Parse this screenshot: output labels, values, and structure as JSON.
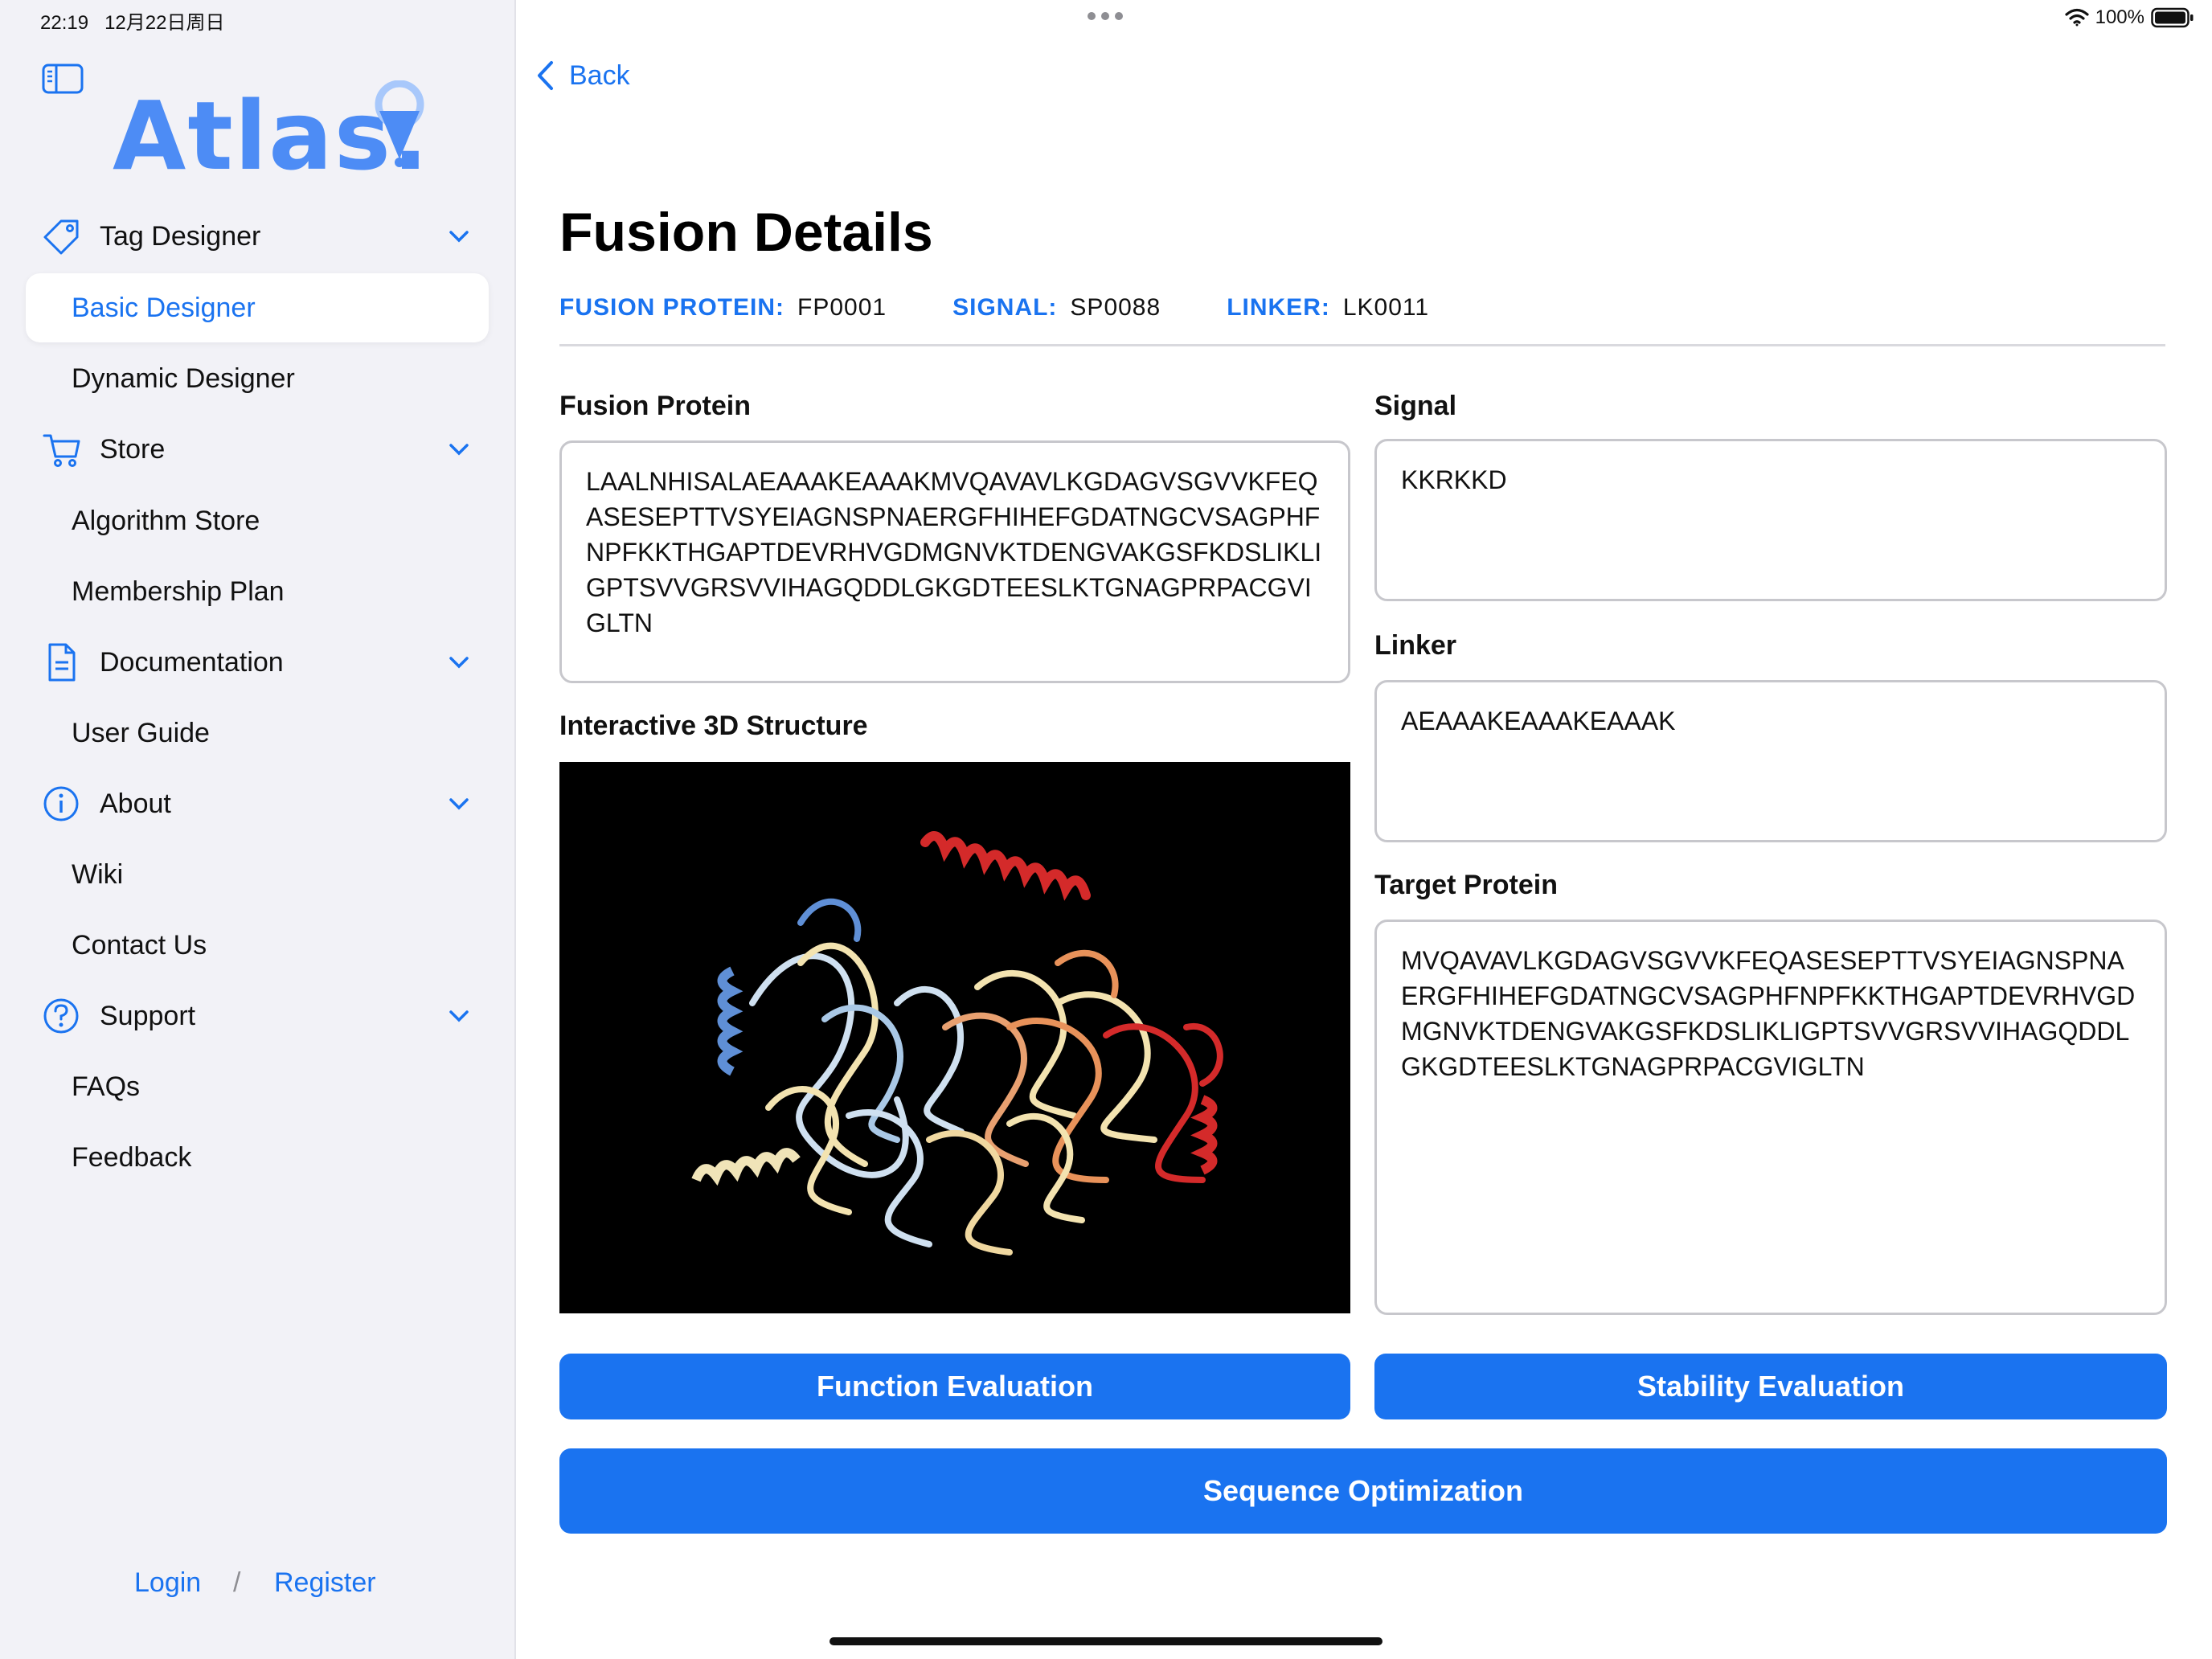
{
  "status_bar": {
    "time": "22:19",
    "date": "12月22日周日",
    "battery": "100%"
  },
  "sidebar": {
    "logo_text": "Atlas.",
    "groups": [
      {
        "label": "Tag Designer",
        "icon": "tag-icon",
        "items": [
          "Basic Designer",
          "Dynamic Designer"
        ]
      },
      {
        "label": "Store",
        "icon": "cart-icon",
        "items": [
          "Algorithm Store",
          "Membership Plan"
        ]
      },
      {
        "label": "Documentation",
        "icon": "document-icon",
        "items": [
          "User Guide"
        ]
      },
      {
        "label": "About",
        "icon": "info-icon",
        "items": [
          "Wiki",
          "Contact Us"
        ]
      },
      {
        "label": "Support",
        "icon": "question-icon",
        "items": [
          "FAQs",
          "Feedback"
        ]
      }
    ],
    "active_item": "Basic Designer",
    "login": "Login",
    "separator": "/",
    "register": "Register"
  },
  "header": {
    "back_label": "Back",
    "title": "Fusion Details",
    "meta": [
      {
        "key": "FUSION PROTEIN:",
        "value": "FP0001"
      },
      {
        "key": "SIGNAL:",
        "value": "SP0088"
      },
      {
        "key": "LINKER:",
        "value": "LK0011"
      }
    ]
  },
  "sections": {
    "fusion_protein": {
      "label": "Fusion Protein",
      "sequence": "LAALNHISALAEAAAKEAAAKMVQAVAVLKGDAGVSGVVKFEQASESEPTTVSYEIAGNSPNAERGFHIHEFGDATNGCVSAGPHFNPFKKTHGAPTDEVRHVGDMGNVKTDENGVAKGSFKDSLIKLIGPTSVVGRSVVIHAGQDDLGKGDTEESLKTGNAGPRPACGVIGLTN"
    },
    "structure": {
      "label": "Interactive 3D Structure"
    },
    "signal": {
      "label": "Signal",
      "sequence": "KKRKKD"
    },
    "linker": {
      "label": "Linker",
      "sequence": "AEAAAKEAAAKEAAAK"
    },
    "target_protein": {
      "label": "Target Protein",
      "sequence": "MVQAVAVLKGDAGVSGVVKFEQASESEPTTVSYEIAGNSPNAERGFHIHEFGDATNGCVSAGPHFNPFKKTHGAPTDEVRHVGDMGNVKTDENGVAKGSFKDSLIKLIGPTSVVGRSVVIHAGQDDLGKGDTEESLKTGNAGPRPACGVIGLTN"
    }
  },
  "actions": {
    "function_evaluation": "Function Evaluation",
    "stability_evaluation": "Stability Evaluation",
    "sequence_optimization": "Sequence Optimization"
  },
  "colors": {
    "accent": "#1a73f0",
    "logo": "#4d8cf5",
    "sidebar_bg": "#f2f2f7"
  }
}
